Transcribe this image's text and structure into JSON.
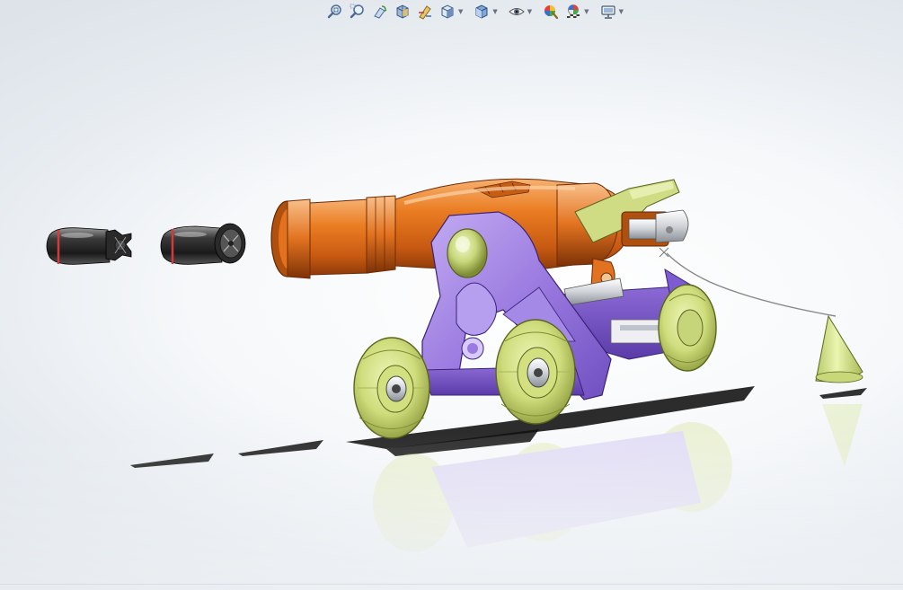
{
  "heads_up_toolbar": {
    "tools": [
      {
        "icon": "zoom-to-fit-icon"
      },
      {
        "icon": "zoom-to-area-icon"
      },
      {
        "icon": "previous-view-icon"
      },
      {
        "icon": "section-view-icon"
      },
      {
        "icon": "dynamic-annotation-icon"
      },
      {
        "icon": "view-orientation-icon",
        "dropdown": true
      },
      {
        "icon": "display-style-icon",
        "dropdown": true
      },
      {
        "icon": "hide-show-items-icon",
        "dropdown": true
      },
      {
        "icon": "edit-appearance-icon"
      },
      {
        "icon": "apply-scene-icon",
        "dropdown": true
      },
      {
        "icon": "view-settings-icon",
        "dropdown": true
      }
    ]
  },
  "model": {
    "components": [
      "cannon-barrel",
      "carriage-frame",
      "front-wheels",
      "rear-wheels",
      "projectile-1",
      "projectile-2",
      "trigger-cone",
      "lanyard"
    ],
    "colors": {
      "barrel": "#e2721f",
      "carriage": "#9b7be0",
      "wheels": "#d5e38a",
      "projectile": "#2a2a2a",
      "projectile_band": "#d33a3a",
      "cone": "#d6e890",
      "shadow": "#1a1a1a"
    }
  }
}
